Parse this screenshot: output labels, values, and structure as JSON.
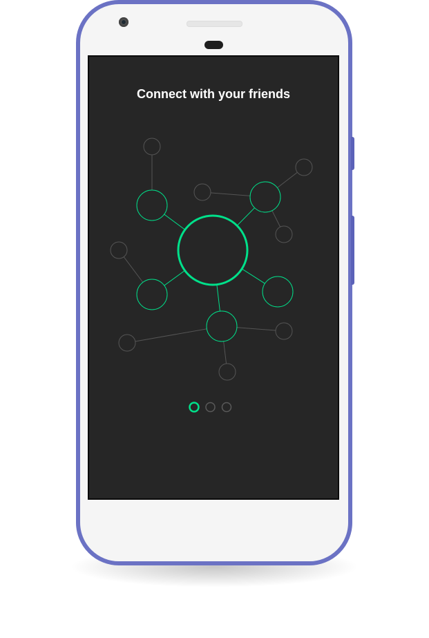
{
  "screen": {
    "title": "Connect with your friends",
    "background": "#262626",
    "accent": "#00e08a",
    "node_color": "#555555"
  },
  "device": {
    "frame_color": "#6b72c4",
    "body_color": "#f5f5f5"
  },
  "illustration": {
    "icon": "friend-network-graph"
  },
  "pager": {
    "pages": 3,
    "current": 1
  }
}
